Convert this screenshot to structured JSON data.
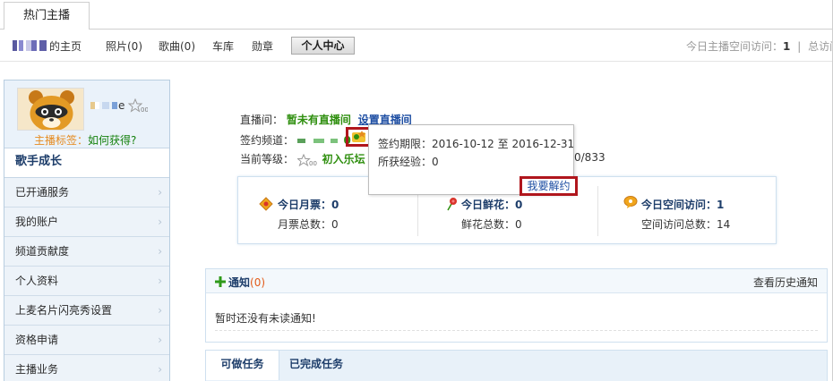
{
  "tabs": {
    "hot_anchor": "热门主播"
  },
  "nav": {
    "home_suffix": "的主页",
    "photos": "照片(0)",
    "songs": "歌曲(0)",
    "garage": "车库",
    "medals": "勋章",
    "personal_center": "个人中心",
    "visit_label": "今日主播空间访问：",
    "visit_value": "1",
    "visit_sep": "|",
    "visit_total_label": "总访问"
  },
  "profile": {
    "name_suffix": "e",
    "tag_label": "主播标签：",
    "tag_link": "如何获得?"
  },
  "sidebar": {
    "growth": "歌手成长",
    "items": [
      {
        "label": "已开通服务"
      },
      {
        "label": "我的账户"
      },
      {
        "label": "频道贡献度"
      },
      {
        "label": "个人资料"
      },
      {
        "label": "上麦名片闪亮秀设置"
      },
      {
        "label": "资格申请"
      },
      {
        "label": "主播业务"
      }
    ]
  },
  "info": {
    "live_label": "直播间：",
    "live_status": "暂未有直播间",
    "live_setup": "设置直播间",
    "channel_label": "签约频道：",
    "channel_suffix": "0",
    "level_label": "当前等级：",
    "level_name": "初入乐坛",
    "progress_tail": "0/833"
  },
  "popup": {
    "period_label": "签约期限：",
    "period_start": "2016-10-12",
    "period_to": "至",
    "period_end": "2016-12-31",
    "exp_label": "所获经验：",
    "exp_value": "0",
    "terminate": "我要解约"
  },
  "stats": {
    "ticket_title": "今日月票：",
    "ticket_value": "0",
    "ticket_total_label": "月票总数：",
    "ticket_total": "0",
    "flower_title": "今日鲜花：",
    "flower_value": "0",
    "flower_total_label": "鲜花总数：",
    "flower_total": "0",
    "visit_title": "今日空间访问：",
    "visit_value": "1",
    "visit_total_label": "空间访问总数：",
    "visit_total": "14"
  },
  "notice": {
    "title": "通知",
    "count": "(0)",
    "history": "查看历史通知",
    "empty": "暂时还没有未读通知!"
  },
  "tasks": {
    "available": "可做任务",
    "completed": "已完成任务"
  },
  "colors": {
    "accent_green": "#2f8f0f",
    "link_blue": "#1f4fa3",
    "highlight_red": "#b0161d",
    "tag_orange": "#e58a1f"
  }
}
